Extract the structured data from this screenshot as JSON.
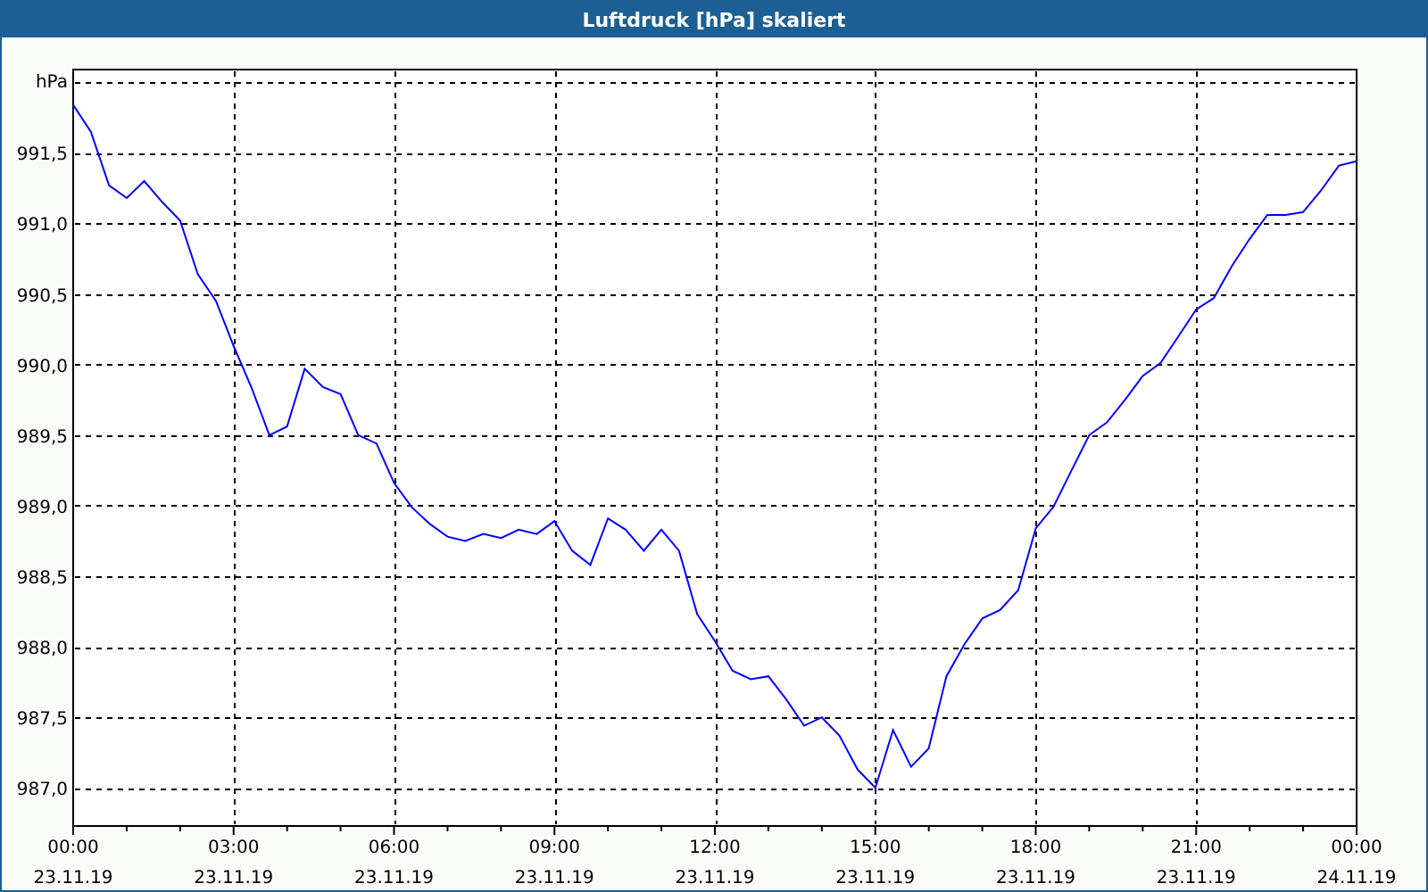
{
  "window": {
    "title": "Luftdruck [hPa] skaliert"
  },
  "chart": {
    "chart_data": {
      "type": "line",
      "ylabel": "hPa",
      "x": [
        0,
        0.33,
        0.67,
        1,
        1.33,
        1.67,
        2,
        2.33,
        2.67,
        3,
        3.33,
        3.67,
        4,
        4.33,
        4.67,
        5,
        5.33,
        5.67,
        6,
        6.33,
        6.67,
        7,
        7.33,
        7.67,
        8,
        8.33,
        8.67,
        9,
        9.33,
        9.67,
        10,
        10.33,
        10.67,
        11,
        11.33,
        11.67,
        12,
        12.33,
        12.67,
        13,
        13.33,
        13.67,
        14,
        14.33,
        14.67,
        15,
        15.33,
        15.67,
        16,
        16.33,
        16.67,
        17,
        17.33,
        17.67,
        18,
        18.33,
        18.67,
        19,
        19.33,
        19.67,
        20,
        20.33,
        20.67,
        21,
        21.33,
        21.67,
        22,
        22.33,
        22.67,
        23,
        23.33,
        23.67,
        24
      ],
      "series": [
        {
          "color": "#0000ff",
          "values": [
            991.84,
            991.65,
            991.27,
            991.18,
            991.3,
            991.15,
            991.02,
            990.64,
            990.45,
            990.13,
            989.84,
            989.5,
            989.56,
            989.97,
            989.84,
            989.79,
            989.5,
            989.44,
            989.16,
            988.99,
            988.87,
            988.78,
            988.75,
            988.8,
            988.77,
            988.83,
            988.8,
            988.89,
            988.68,
            988.58,
            988.91,
            988.83,
            988.68,
            988.83,
            988.68,
            988.23,
            988.04,
            987.83,
            987.77,
            987.79,
            987.63,
            987.44,
            987.5,
            987.37,
            987.13,
            987.0,
            987.41,
            987.15,
            987.28,
            987.79,
            988.02,
            988.2,
            988.26,
            988.4,
            988.84,
            988.99,
            989.25,
            989.5,
            989.59,
            989.75,
            989.92,
            990.01,
            990.2,
            990.39,
            990.47,
            990.7,
            990.89,
            991.06,
            991.06,
            991.08,
            991.23,
            991.41,
            991.44
          ]
        }
      ],
      "xlim": [
        0,
        24
      ],
      "ylim": [
        986.73,
        992.09
      ],
      "xticks": [
        {
          "value": 0,
          "label": "00:00"
        },
        {
          "value": 3,
          "label": "03:00"
        },
        {
          "value": 6,
          "label": "06:00"
        },
        {
          "value": 9,
          "label": "09:00"
        },
        {
          "value": 12,
          "label": "12:00"
        },
        {
          "value": 15,
          "label": "15:00"
        },
        {
          "value": 18,
          "label": "18:00"
        },
        {
          "value": 21,
          "label": "21:00"
        },
        {
          "value": 24,
          "label": "00:00"
        }
      ],
      "annotations": [
        "23.11.19",
        "23.11.19",
        "23.11.19",
        "23.11.19",
        "23.11.19",
        "23.11.19",
        "23.11.19",
        "23.11.19",
        "24.11.19"
      ],
      "yticks": [
        {
          "value": 987,
          "label": "987,0"
        },
        {
          "value": 987.5,
          "label": "987,5"
        },
        {
          "value": 988,
          "label": "988,0"
        },
        {
          "value": 988.5,
          "label": "988,5"
        },
        {
          "value": 989,
          "label": "989,0"
        },
        {
          "value": 989.5,
          "label": "989,5"
        },
        {
          "value": 990,
          "label": "990,0"
        },
        {
          "value": 990.5,
          "label": "990,5"
        },
        {
          "value": 991,
          "label": "991,0"
        },
        {
          "value": 991.5,
          "label": "991,5"
        }
      ],
      "grid": true,
      "ref_lines": [
        {
          "axis": "y",
          "value": 992
        }
      ]
    }
  }
}
